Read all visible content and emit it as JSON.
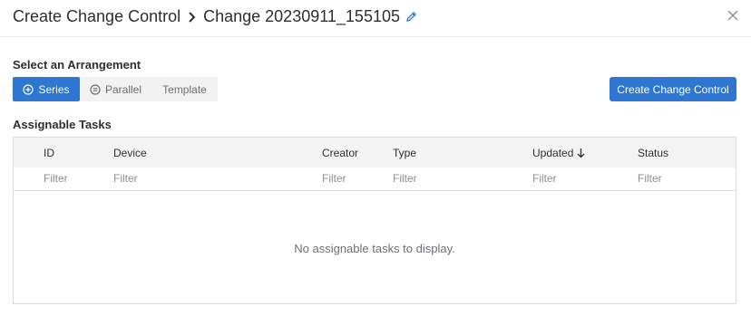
{
  "header": {
    "title": "Create Change Control",
    "subtitle": "Change 20230911_155105"
  },
  "arrangement": {
    "label": "Select an Arrangement",
    "options": [
      {
        "label": "Series",
        "selected": true
      },
      {
        "label": "Parallel",
        "selected": false
      },
      {
        "label": "Template",
        "selected": false
      }
    ]
  },
  "actions": {
    "create_label": "Create Change Control"
  },
  "tasks": {
    "label": "Assignable Tasks",
    "columns": [
      "ID",
      "Device",
      "Creator",
      "Type",
      "Updated",
      "Status"
    ],
    "sorted_column": "Updated",
    "sort_direction": "descending",
    "filter_placeholder": "Filter",
    "empty_message": "No assignable tasks to display."
  },
  "colors": {
    "accent": "#2f76d2",
    "text": "#2b2f33",
    "muted": "#8a8e93"
  }
}
